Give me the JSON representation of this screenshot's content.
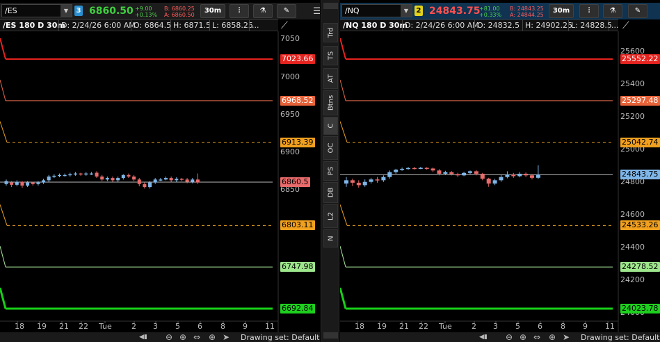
{
  "side_tabs": [
    "Trd",
    "TS",
    "AT",
    "Btns",
    "C",
    "OC",
    "PS",
    "DB",
    "L2",
    "N"
  ],
  "side_tab_selected": 4,
  "colors": {
    "up": "#7fb6e8",
    "down": "#e86a6a",
    "red_line": "#e5231f",
    "orange_line": "#e86a4a",
    "dashed_line": "#e8a020",
    "lightgreen_line": "#a8e89a",
    "green_line": "#18d018",
    "price_line": "#bbbbbb",
    "link_left": "#2a8fd0",
    "link_right": "#e2d21c"
  },
  "icons": [
    "bars-icon",
    "flask-icon",
    "drawing-icon",
    "hamburger-menu-icon",
    "drawing-tools-icon",
    "zoom-out-icon",
    "zoom-in-icon",
    "pan-icon",
    "crosshair-icon",
    "cursor-icon",
    "chevron-down-icon"
  ],
  "panels": [
    {
      "symbol": "/ES",
      "link_number": "3",
      "last_price": "6860.50",
      "change_abs": "+9.00",
      "change_pct": "+0.13%",
      "bid": "B: 6860.25",
      "ask": "A: 6860.50",
      "timeframe": "30m",
      "chart_title": "/ES 180 D 30m",
      "date": "D: 2/24/26 6:00 AM",
      "open": "O: 6864.5",
      "high": "H: 6871.5",
      "low": "L: 6858.25",
      "more": "...",
      "drawing_set": "Drawing set: Default"
    },
    {
      "symbol": "/NQ",
      "link_number": "2",
      "last_price": "24843.75",
      "change_abs": "+81.00",
      "change_pct": "+0.33%",
      "bid": "B: 24843.25",
      "ask": "A: 24844.25",
      "timeframe": "30m",
      "chart_title": "/NQ 180 D 30m",
      "date": "D: 2/24/26 6:00 AM",
      "open": "O: 24832.5",
      "high": "H: 24902.25",
      "low": "L: 24828.5",
      "more": "...",
      "drawing_set": "Drawing set: Default"
    }
  ],
  "chart_data": [
    {
      "type": "candlestick",
      "title": "/ES 180 D 30m",
      "y_ticks": [
        6850,
        6900,
        6950,
        7000,
        7050
      ],
      "x_ticks": [
        "18",
        "19",
        "21",
        "22",
        "Tue",
        "2",
        "3",
        "5",
        "6",
        "8",
        "9",
        "11"
      ],
      "levels": [
        {
          "value": 7023.66,
          "label": "7023.66",
          "style": "red"
        },
        {
          "value": 6968.52,
          "label": "6968.52",
          "style": "orange"
        },
        {
          "value": 6913.39,
          "label": "6913.39",
          "style": "dashed"
        },
        {
          "value": 6860.5,
          "label": "6860.5",
          "style": "last"
        },
        {
          "value": 6803.11,
          "label": "6803.11",
          "style": "dashed"
        },
        {
          "value": 6747.98,
          "label": "6747.98",
          "style": "lightgreen"
        },
        {
          "value": 6692.84,
          "label": "6692.84",
          "style": "green"
        }
      ],
      "candles": [
        [
          6858,
          6862,
          6856,
          6864
        ],
        [
          6860,
          6857,
          6854,
          6862
        ],
        [
          6857,
          6861,
          6855,
          6863
        ],
        [
          6861,
          6856,
          6853,
          6862
        ],
        [
          6856,
          6860,
          6854,
          6862
        ],
        [
          6860,
          6858,
          6856,
          6861
        ],
        [
          6858,
          6860,
          6856,
          6862
        ],
        [
          6860,
          6863,
          6858,
          6865
        ],
        [
          6863,
          6868,
          6861,
          6870
        ],
        [
          6868,
          6869,
          6866,
          6871
        ],
        [
          6869,
          6870,
          6867,
          6872
        ],
        [
          6870,
          6870,
          6868,
          6872
        ],
        [
          6870,
          6871,
          6868,
          6873
        ],
        [
          6871,
          6872,
          6869,
          6874
        ],
        [
          6872,
          6871,
          6869,
          6873
        ],
        [
          6871,
          6872,
          6869,
          6874
        ],
        [
          6872,
          6872,
          6870,
          6874
        ],
        [
          6873,
          6868,
          6866,
          6875
        ],
        [
          6868,
          6864,
          6862,
          6870
        ],
        [
          6864,
          6866,
          6862,
          6868
        ],
        [
          6866,
          6863,
          6861,
          6868
        ],
        [
          6863,
          6866,
          6861,
          6868
        ],
        [
          6866,
          6870,
          6864,
          6871
        ],
        [
          6870,
          6868,
          6866,
          6872
        ],
        [
          6868,
          6864,
          6862,
          6870
        ],
        [
          6864,
          6858,
          6855,
          6866
        ],
        [
          6858,
          6854,
          6852,
          6860
        ],
        [
          6854,
          6860,
          6852,
          6862
        ],
        [
          6860,
          6864,
          6858,
          6866
        ],
        [
          6864,
          6864,
          6862,
          6866
        ],
        [
          6864,
          6866,
          6863,
          6868
        ],
        [
          6866,
          6863,
          6861,
          6868
        ],
        [
          6863,
          6865,
          6861,
          6867
        ],
        [
          6865,
          6864,
          6862,
          6866
        ],
        [
          6864,
          6861,
          6859,
          6866
        ],
        [
          6861,
          6864,
          6859,
          6866
        ],
        [
          6864,
          6860,
          6858,
          6872
        ]
      ]
    },
    {
      "type": "candlestick",
      "title": "/NQ 180 D 30m",
      "y_ticks": [
        24000,
        24200,
        24400,
        24600,
        24800,
        25000,
        25200,
        25400,
        25600
      ],
      "x_ticks": [
        "18",
        "19",
        "21",
        "22",
        "Tue",
        "2",
        "3",
        "5",
        "6",
        "8",
        "9",
        "11"
      ],
      "levels": [
        {
          "value": 25552.22,
          "label": "25552.22",
          "style": "red"
        },
        {
          "value": 25297.48,
          "label": "25297.48",
          "style": "orange"
        },
        {
          "value": 25042.74,
          "label": "25042.74",
          "style": "dashed"
        },
        {
          "value": 24843.75,
          "label": "24843.75",
          "style": "last"
        },
        {
          "value": 24533.26,
          "label": "24533.26",
          "style": "dashed"
        },
        {
          "value": 24278.52,
          "label": "24278.52",
          "style": "lightgreen"
        },
        {
          "value": 24023.78,
          "label": "24023.78",
          "style": "green"
        }
      ],
      "candles": [
        [
          24790,
          24810,
          24770,
          24830
        ],
        [
          24810,
          24795,
          24775,
          24820
        ],
        [
          24795,
          24780,
          24765,
          24810
        ],
        [
          24780,
          24800,
          24770,
          24815
        ],
        [
          24800,
          24815,
          24790,
          24825
        ],
        [
          24815,
          24810,
          24795,
          24830
        ],
        [
          24810,
          24830,
          24800,
          24840
        ],
        [
          24830,
          24860,
          24820,
          24870
        ],
        [
          24860,
          24875,
          24850,
          24880
        ],
        [
          24875,
          24880,
          24868,
          24888
        ],
        [
          24880,
          24885,
          24875,
          24892
        ],
        [
          24885,
          24883,
          24876,
          24892
        ],
        [
          24883,
          24886,
          24878,
          24892
        ],
        [
          24886,
          24882,
          24875,
          24890
        ],
        [
          24882,
          24870,
          24860,
          24888
        ],
        [
          24870,
          24850,
          24840,
          24878
        ],
        [
          24850,
          24860,
          24842,
          24868
        ],
        [
          24860,
          24848,
          24840,
          24866
        ],
        [
          24848,
          24840,
          24830,
          24856
        ],
        [
          24840,
          24855,
          24835,
          24862
        ],
        [
          24855,
          24865,
          24848,
          24870
        ],
        [
          24865,
          24850,
          24840,
          24872
        ],
        [
          24850,
          24820,
          24810,
          24855
        ],
        [
          24820,
          24790,
          24770,
          24825
        ],
        [
          24790,
          24810,
          24780,
          24820
        ],
        [
          24810,
          24830,
          24800,
          24845
        ],
        [
          24830,
          24845,
          24822,
          24865
        ],
        [
          24845,
          24835,
          24825,
          24855
        ],
        [
          24835,
          24850,
          24828,
          24860
        ],
        [
          24850,
          24840,
          24830,
          24858
        ],
        [
          24840,
          24825,
          24815,
          24848
        ],
        [
          24825,
          24844,
          24818,
          24902
        ]
      ]
    }
  ]
}
